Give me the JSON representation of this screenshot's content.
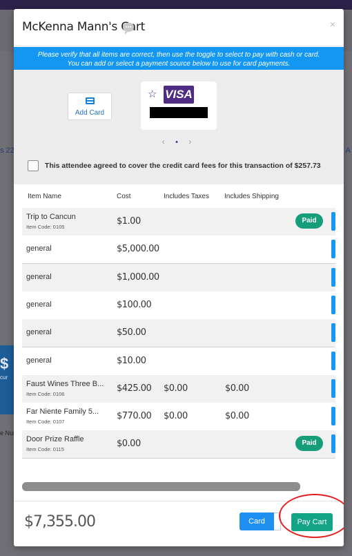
{
  "background": {
    "text_left": "s 22",
    "text_right": "A",
    "card_value": "$",
    "card_sub": "cur",
    "label_left": "e Nun"
  },
  "modal": {
    "title": "McKenna Mann's Cart",
    "close_label": "×"
  },
  "payment": {
    "notice_line1": "Please verify that all items are correct, then use the toggle to select to pay with cash or card.",
    "notice_line2": "You can add or select a payment source below to use for card payments.",
    "add_card_label": "Add Card",
    "card_brand": "VISA",
    "carousel_prev": "‹",
    "carousel_dot": "•",
    "carousel_next": "›",
    "fee_text": "This attendee agreed to cover the credit card fees for this transaction of $257.73"
  },
  "table": {
    "headers": {
      "item_name": "Item Name",
      "cost": "Cost",
      "includes_taxes": "Includes Taxes",
      "includes_shipping": "Includes Shipping"
    },
    "rows": [
      {
        "name": "Trip to Cancun",
        "code": "Item Code: 0105",
        "cost": "$1.00",
        "taxes": "",
        "shipping": "",
        "status": "Paid"
      },
      {
        "name": "general",
        "code": "",
        "cost": "$5,000.00",
        "taxes": "",
        "shipping": "",
        "status": ""
      },
      {
        "name": "general",
        "code": "",
        "cost": "$1,000.00",
        "taxes": "",
        "shipping": "",
        "status": ""
      },
      {
        "name": "general",
        "code": "",
        "cost": "$100.00",
        "taxes": "",
        "shipping": "",
        "status": ""
      },
      {
        "name": "general",
        "code": "",
        "cost": "$50.00",
        "taxes": "",
        "shipping": "",
        "status": ""
      },
      {
        "name": "general",
        "code": "",
        "cost": "$10.00",
        "taxes": "",
        "shipping": "",
        "status": ""
      },
      {
        "name": "Faust Wines Three B...",
        "code": "Item Code: 0106",
        "cost": "$425.00",
        "taxes": "$0.00",
        "shipping": "$0.00",
        "status": ""
      },
      {
        "name": "Far Niente Family 5...",
        "code": "Item Code: 0107",
        "cost": "$770.00",
        "taxes": "$0.00",
        "shipping": "$0.00",
        "status": ""
      },
      {
        "name": "Door Prize Raffle",
        "code": "Item Code: 0115",
        "cost": "$0.00",
        "taxes": "",
        "shipping": "",
        "status": "Paid"
      }
    ]
  },
  "footer": {
    "total": "$7,355.00",
    "card_toggle_label": "Card",
    "pay_cart_label": "Pay Cart"
  },
  "colors": {
    "notice_blue": "#1497f3",
    "paid_green": "#169d7a",
    "pay_button_green": "#13a488",
    "card_button_blue": "#1f8ff1",
    "visa_purple": "#4f2b84",
    "annotation_red": "#e32020"
  }
}
